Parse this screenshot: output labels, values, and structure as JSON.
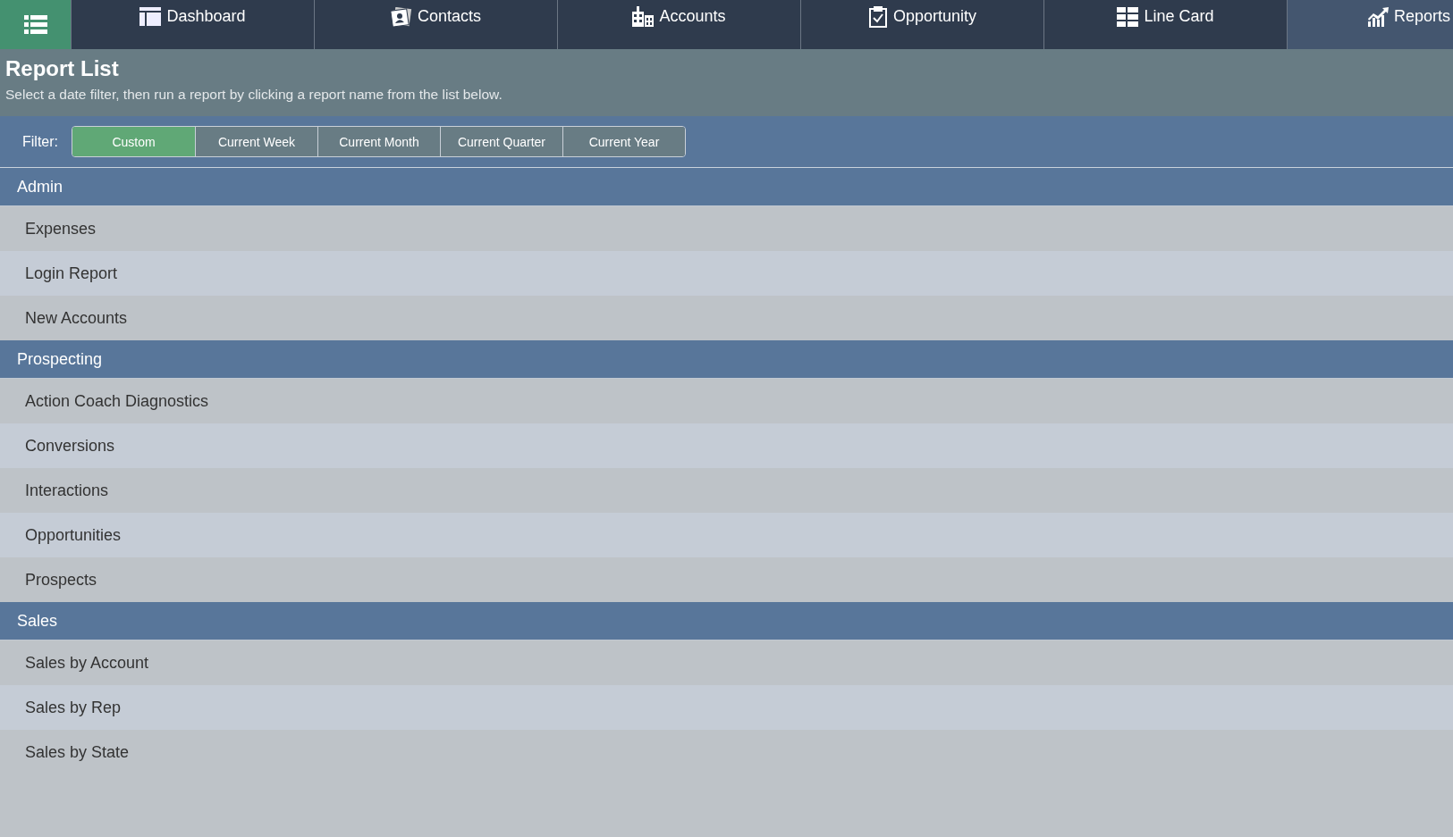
{
  "nav": {
    "tabs": [
      {
        "label": "Dashboard",
        "selected": false
      },
      {
        "label": "Contacts",
        "selected": false
      },
      {
        "label": "Accounts",
        "selected": false
      },
      {
        "label": "Opportunity",
        "selected": false
      },
      {
        "label": "Line Card",
        "selected": false
      },
      {
        "label": "Reports",
        "selected": true
      }
    ]
  },
  "header": {
    "title": "Report List",
    "subtitle": "Select a date filter, then run a report by clicking a report name from the list below."
  },
  "filter": {
    "label": "Filter:",
    "options": [
      {
        "label": "Custom",
        "selected": true
      },
      {
        "label": "Current Week",
        "selected": false
      },
      {
        "label": "Current Month",
        "selected": false
      },
      {
        "label": "Current Quarter",
        "selected": false
      },
      {
        "label": "Current Year",
        "selected": false
      }
    ]
  },
  "groups": [
    {
      "title": "Admin",
      "reports": [
        "Expenses",
        "Login Report",
        "New Accounts"
      ]
    },
    {
      "title": "Prospecting",
      "reports": [
        "Action Coach Diagnostics",
        "Conversions",
        "Interactions",
        "Opportunities",
        "Prospects"
      ]
    },
    {
      "title": "Sales",
      "reports": [
        "Sales by Account",
        "Sales by Rep",
        "Sales by State"
      ]
    }
  ]
}
